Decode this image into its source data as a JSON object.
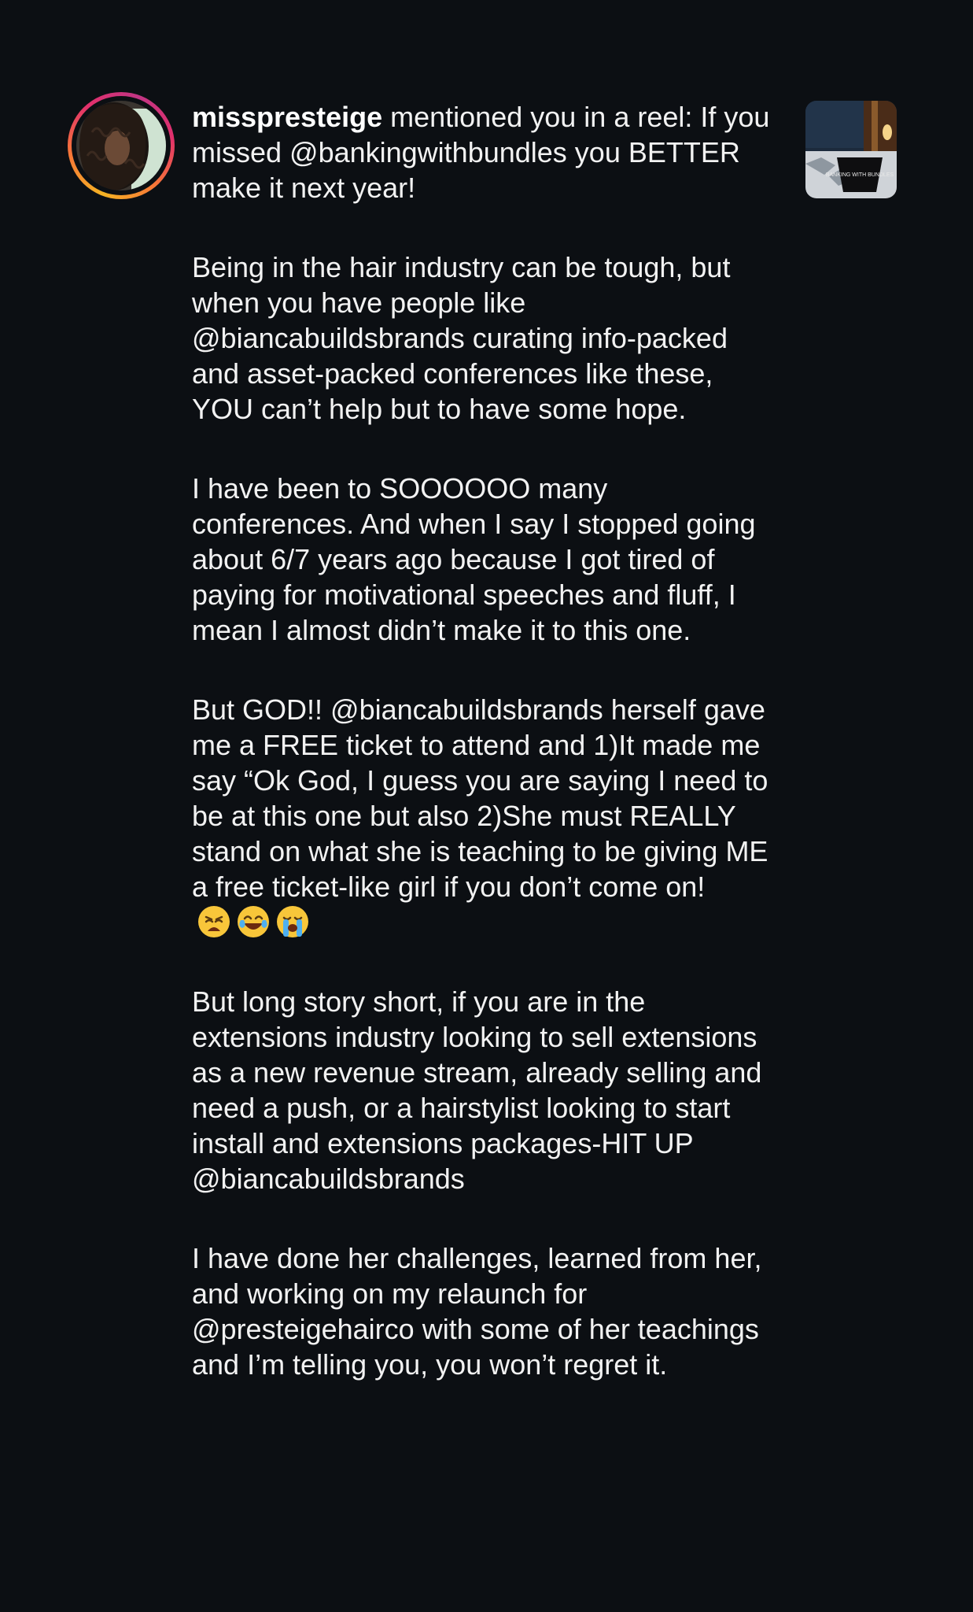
{
  "notification": {
    "username": "misspresteige",
    "headline": " mentioned you in a reel: If you missed @bankingwithbundles you BETTER make it next year!",
    "paragraphs": [
      "Being in the hair industry can be tough, but when you have people like @biancabuildsbrands curating info-packed and asset-packed conferences like these, YOU can’t help but to have some hope.",
      "I have been to SOOOOOO many conferences. And when I say I stopped going about 6/7 years ago because I got tired of paying for motivational speeches and fluff, I mean I almost didn’t make it to this one."
    ],
    "paragraph_emoji": "But GOD!! @biancabuildsbrands herself gave me a FREE ticket to attend and 1)It made me say “Ok God, I guess you are saying I need to be at this one but also 2)She must REALLY stand on what she is teaching to be giving ME a free ticket-like girl if you don’t come on!",
    "emojis": [
      "weary-face-emoji",
      "face-with-tears-of-joy-emoji",
      "loudly-crying-face-emoji"
    ],
    "paragraphs_after": [
      "But long story short, if you are in the extensions industry looking to sell extensions as a new revenue stream, already selling and need a push, or a hairstylist looking to start install and extensions packages-HIT UP @biancabuildsbrands",
      "I have done her challenges, learned from her, and working on my relaunch for @presteigehairco with some of her teachings and I’m telling you, you won’t regret it."
    ],
    "thumbnail": {
      "brand_text": "BANKING WITH BUNDLES"
    }
  },
  "colors": {
    "background": "#0c0f13",
    "text": "#f2f2f2",
    "ring_start": "#f5b324",
    "ring_end": "#c13584"
  }
}
